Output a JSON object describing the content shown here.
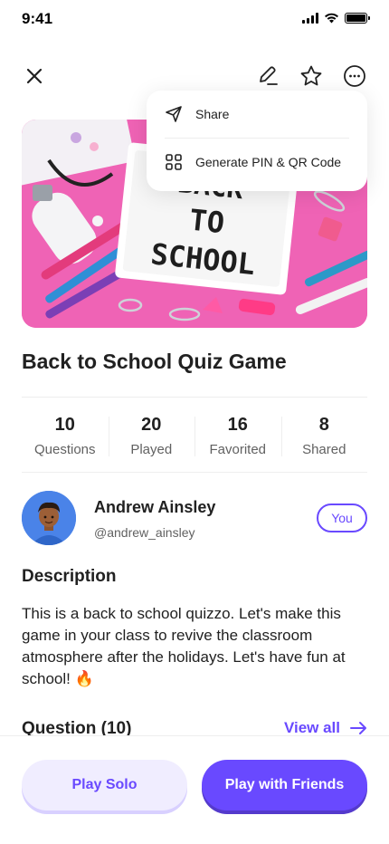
{
  "status_bar": {
    "time": "9:41"
  },
  "menu": {
    "items": [
      {
        "label": "Share",
        "icon": "send-icon"
      },
      {
        "label": "Generate PIN & QR Code",
        "icon": "qr-grid-icon"
      }
    ]
  },
  "hero": {
    "sign_text": [
      "BACK",
      "TO",
      "SCHOOL"
    ]
  },
  "quiz": {
    "title": "Back to School Quiz Game"
  },
  "stats": [
    {
      "value": "10",
      "label": "Questions"
    },
    {
      "value": "20",
      "label": "Played"
    },
    {
      "value": "16",
      "label": "Favorited"
    },
    {
      "value": "8",
      "label": "Shared"
    }
  ],
  "author": {
    "name": "Andrew Ainsley",
    "handle": "@andrew_ainsley",
    "badge": "You"
  },
  "description": {
    "heading": "Description",
    "text": "This is a back to school quizzo. Let's make this game in your class to revive the classroom atmosphere after the holidays. Let's have fun at school! 🔥"
  },
  "questions": {
    "heading": "Question (10)",
    "view_all": "View all"
  },
  "actions": {
    "solo": "Play Solo",
    "friends": "Play with Friends"
  },
  "colors": {
    "primary": "#6949ff",
    "primary_light": "#f0edff",
    "hero_bg": "#ef63b5"
  }
}
